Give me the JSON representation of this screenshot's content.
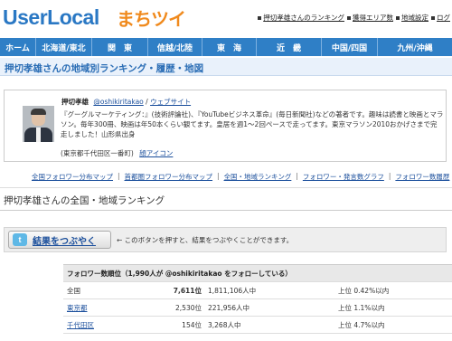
{
  "header": {
    "logo_en": "UserLocal",
    "logo_jp": "まちツイ",
    "links": [
      "押切孝雄さんのランキング",
      "獲得エリア数",
      "地域設定",
      "ログ"
    ]
  },
  "nav": {
    "items": [
      "ホーム",
      "北海道/東北",
      "関　東",
      "信越/北陸",
      "東　海",
      "近　畿",
      "中国/四国",
      "九州/沖縄"
    ]
  },
  "page_title": "押切孝雄さんの地域別ランキング・履歴・地図",
  "profile": {
    "name": "押切孝雄",
    "handle": "@oshikiritakao",
    "separator": "/",
    "website_label": "ウェブサイト",
    "bio": "『グーグルマーケティング：』(技術評論社)、『YouTubeビジネス革命』(毎日新聞社)などの著者です。趣味は読書と映画とマラソン。毎年300冊、映画は年50本くらい観てます。皇居を週1〜2回ペースで走ってます。東京マラソン2010おかげさまで完走しました！山形県出身",
    "location": "(東京都千代田区一番町)",
    "icon_link": "顔アイコン"
  },
  "sublinks": [
    "全国フォロワー分布マップ",
    "首都圏フォロワー分布マップ",
    "全国・地域ランキング",
    "フォロワー・発言数グラフ",
    "フォロワー数履歴"
  ],
  "ranking_title": "押切孝雄さんの全国・地域ランキング",
  "tweet": {
    "button_label": "結果をつぶやく",
    "icon_letter": "t",
    "description": "← このボタンを押すと、結果をつぶやくことができます。"
  },
  "follower_table": {
    "header": "フォロワー数順位（1,990人が @oshikiritakao をフォローしている）",
    "rows": [
      {
        "area": "全国",
        "rank": "7,611位",
        "total": "1,811,106人中",
        "percent": "上位 0.42%以内",
        "link": false
      },
      {
        "area": "東京都",
        "rank": "2,530位",
        "total": "221,956人中",
        "percent": "上位 1.1%以内",
        "link": true
      },
      {
        "area": "千代田区",
        "rank": "154位",
        "total": "3,268人中",
        "percent": "上位 4.7%以内",
        "link": true
      }
    ]
  },
  "colors": {
    "nav_bg": "#2f7fc6",
    "logo_blue": "#2a78c4",
    "logo_orange": "#f08a1d",
    "title_text": "#2a6db5"
  }
}
